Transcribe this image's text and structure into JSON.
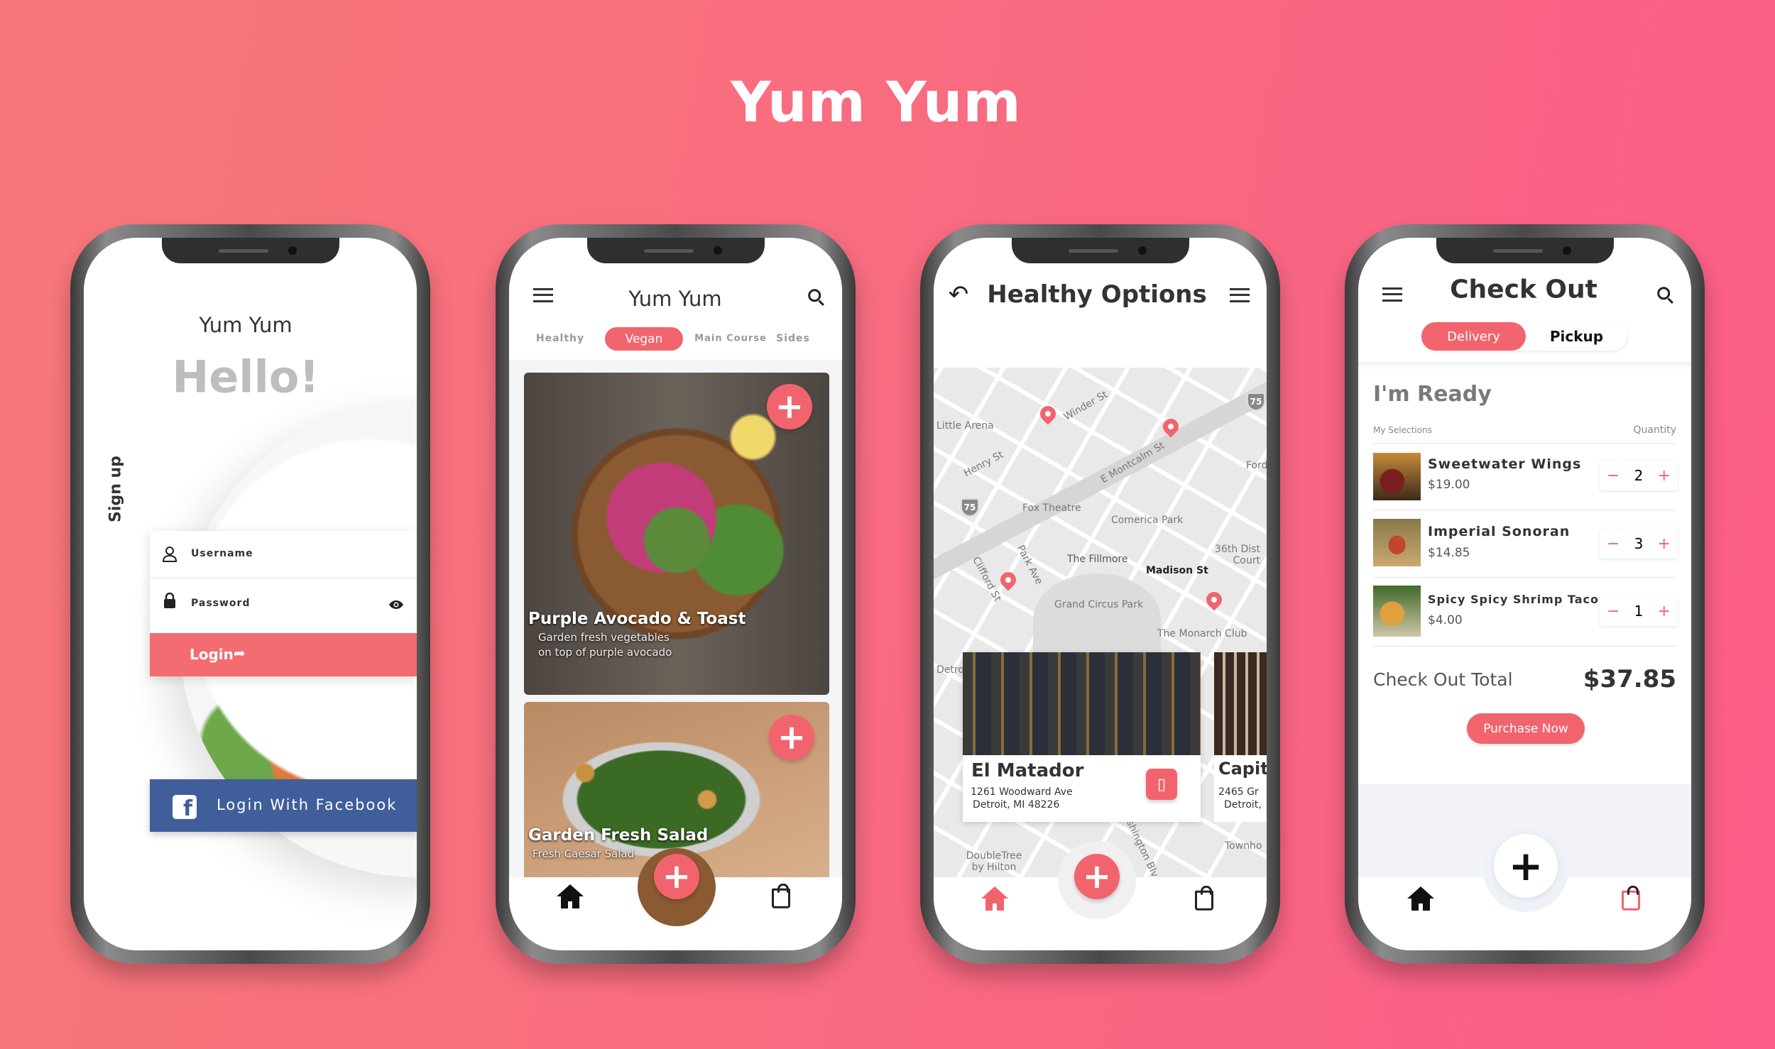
{
  "page_title": "Yum Yum",
  "colors": {
    "accent": "#f2646d",
    "facebook": "#3f5e9a",
    "background_left": "#f7787a",
    "background_right": "#fb5d88"
  },
  "login_screen": {
    "app_name": "Yum Yum",
    "greeting": "Hello!",
    "sign_up_label": "Sign up",
    "username_placeholder": "Username",
    "password_placeholder": "Password",
    "login_label": "Login",
    "facebook_label": "Login With Facebook",
    "icons": [
      "user-icon",
      "lock-icon",
      "eye-icon",
      "share-arrow-icon",
      "facebook-icon"
    ]
  },
  "menu_screen": {
    "title": "Yum Yum",
    "tabs": [
      {
        "label": "Healthy",
        "active": false
      },
      {
        "label": "Vegan",
        "active": true
      },
      {
        "label": "Main Course",
        "active": false
      },
      {
        "label": "Sides",
        "active": false
      }
    ],
    "cards": [
      {
        "title": "Purple Avocado & Toast",
        "subtitle_line1": "Garden fresh vegetables",
        "subtitle_line2": "on top of purple avocado"
      },
      {
        "title": "Garden Fresh Salad",
        "subtitle_line1": "Fresh Caesar Salad"
      }
    ],
    "icons": [
      "menu-icon",
      "search-icon",
      "plus-icon",
      "home-icon",
      "bag-icon"
    ]
  },
  "map_screen": {
    "title": "Healthy Options",
    "map_labels": {
      "little_arena": "Little Arena",
      "winder": "Winder St",
      "henry": "Henry St",
      "montcalm": "E Montcalm St",
      "fox": "Fox Theatre",
      "comerica": "Comerica Park",
      "fillmore": "The Fillmore",
      "madison": "Madison St",
      "court": "36th Dist Court",
      "clifford": "Clifford St",
      "park_ave": "Park Ave",
      "grand_circus": "Grand Circus Park",
      "monarch": "The Monarch Club",
      "doubletree": "DoubleTree by Hilton",
      "washington": "Washington Blv",
      "townho": "Townho",
      "detro": "Detro",
      "ford": "Ford",
      "highway": "75"
    },
    "restaurants": [
      {
        "name": "El Matador",
        "address_line1": "1261 Woodward Ave",
        "address_line2": "Detroit, MI 48226"
      },
      {
        "name": "Capit",
        "address_line1": "2465 Gr",
        "address_line2": "Detroit,"
      }
    ],
    "icons": [
      "back-arrow-icon",
      "menu-icon",
      "map-pin-icon",
      "phone-icon",
      "plus-icon",
      "home-icon",
      "bag-icon"
    ]
  },
  "checkout_screen": {
    "title": "Check Out",
    "toggle": [
      {
        "label": "Delivery",
        "active": true
      },
      {
        "label": "Pickup",
        "active": false
      }
    ],
    "section_title": "I'm Ready",
    "col_selections": "My Selections",
    "col_quantity": "Quantity",
    "items": [
      {
        "name": "Sweetwater Wings",
        "price": "$19.00",
        "quantity": "2"
      },
      {
        "name": "Imperial Sonoran",
        "price": "$14.85",
        "quantity": "3"
      },
      {
        "name": "Spicy Spicy Shrimp Tacos",
        "price": "$4.00",
        "quantity": "1"
      }
    ],
    "minus": "−",
    "plus": "+",
    "total_label": "Check Out Total",
    "total_value": "$37.85",
    "purchase_label": "Purchase Now"
  }
}
